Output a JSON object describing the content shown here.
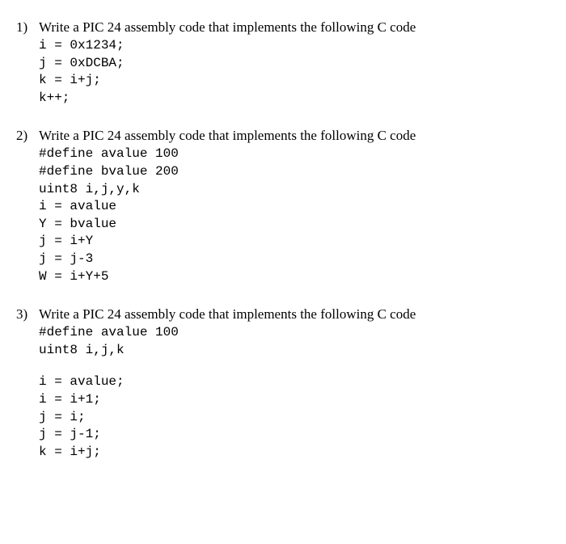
{
  "problems": [
    {
      "number": "1)",
      "prompt": "Write a PIC 24 assembly code that implements the following C code",
      "code_blocks": [
        {
          "extra_top": false,
          "code": "i = 0x1234;\nj = 0xDCBA;\nk = i+j;\nk++;"
        }
      ]
    },
    {
      "number": "2)",
      "prompt": "Write a PIC 24 assembly code that implements the following C code",
      "code_blocks": [
        {
          "extra_top": false,
          "code": "#define avalue 100\n#define bvalue 200\nuint8 i,j,y,k\ni = avalue\nY = bvalue\nj = i+Y\nj = j-3\nW = i+Y+5"
        }
      ]
    },
    {
      "number": "3)",
      "prompt": "Write a PIC 24 assembly code that implements the following C code",
      "code_blocks": [
        {
          "extra_top": false,
          "code": "#define avalue 100\nuint8 i,j,k"
        },
        {
          "extra_top": true,
          "code": "i = avalue;\ni = i+1;\nj = i;\nj = j-1;\nk = i+j;"
        }
      ]
    }
  ]
}
